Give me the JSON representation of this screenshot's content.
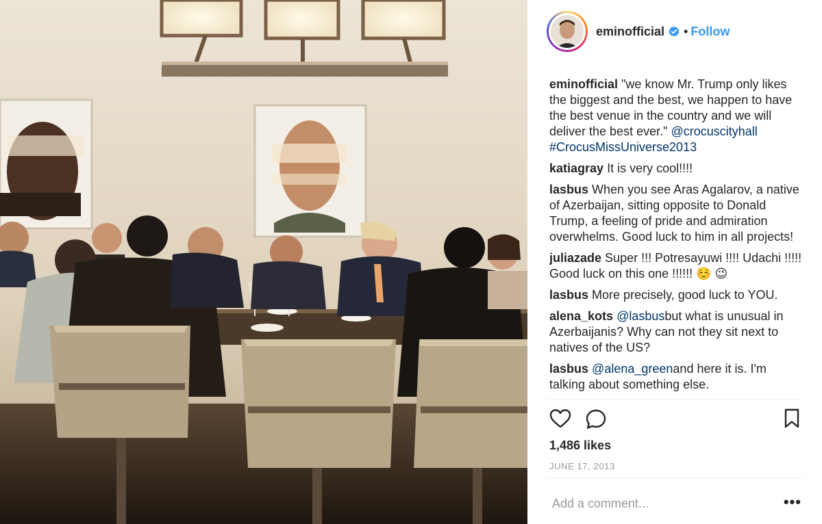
{
  "post": {
    "username": "eminofficial",
    "separator": "•",
    "follow_label": "Follow",
    "likes": "1,486 likes",
    "date": "JUNE 17, 2013",
    "comment_placeholder": "Add a comment...",
    "more_label": "•••"
  },
  "comments": [
    {
      "user": "eminofficial",
      "parts": [
        {
          "t": "\"we know Mr. Trump only likes the biggest and the best, we happen to have the best venue in the country and we will deliver the best ever.\" "
        },
        {
          "t": "@crocuscityhall",
          "link": true
        },
        {
          "t": " "
        },
        {
          "t": "#CrocusMissUniverse2013",
          "link": true
        }
      ]
    },
    {
      "user": "katiagray",
      "parts": [
        {
          "t": "It is very cool!!!!"
        }
      ]
    },
    {
      "user": "lasbus",
      "parts": [
        {
          "t": "When you see Aras Agalarov, a native of Azerbaijan, sitting opposite to Donald Trump, a feeling of pride and admiration overwhelms. Good luck to him in all projects!"
        }
      ]
    },
    {
      "user": "juliazade",
      "parts": [
        {
          "t": "Super !!! Potresayuwi !!!! Udachi !!!!! Good luck on this one !!!!!! ☺️ 😉"
        }
      ]
    },
    {
      "user": "lasbus",
      "parts": [
        {
          "t": "More precisely, good luck to YOU."
        }
      ]
    },
    {
      "user": "alena_kots",
      "parts": [
        {
          "t": "@lasbus",
          "link": true
        },
        {
          "t": "but what is unusual in Azerbaijanis? Why can not they sit next to natives of the US?"
        }
      ]
    },
    {
      "user": "lasbus",
      "parts": [
        {
          "t": "@alena_green",
          "link": true
        },
        {
          "t": "and here it is. I'm talking about something else."
        }
      ]
    }
  ],
  "icons": {
    "like": "heart-icon",
    "comment": "comment-bubble-icon",
    "save": "bookmark-icon",
    "verified": "verified-badge-icon"
  },
  "colors": {
    "follow": "#3897f0",
    "link": "#003569",
    "verified": "#3897f0",
    "date": "#999999"
  }
}
